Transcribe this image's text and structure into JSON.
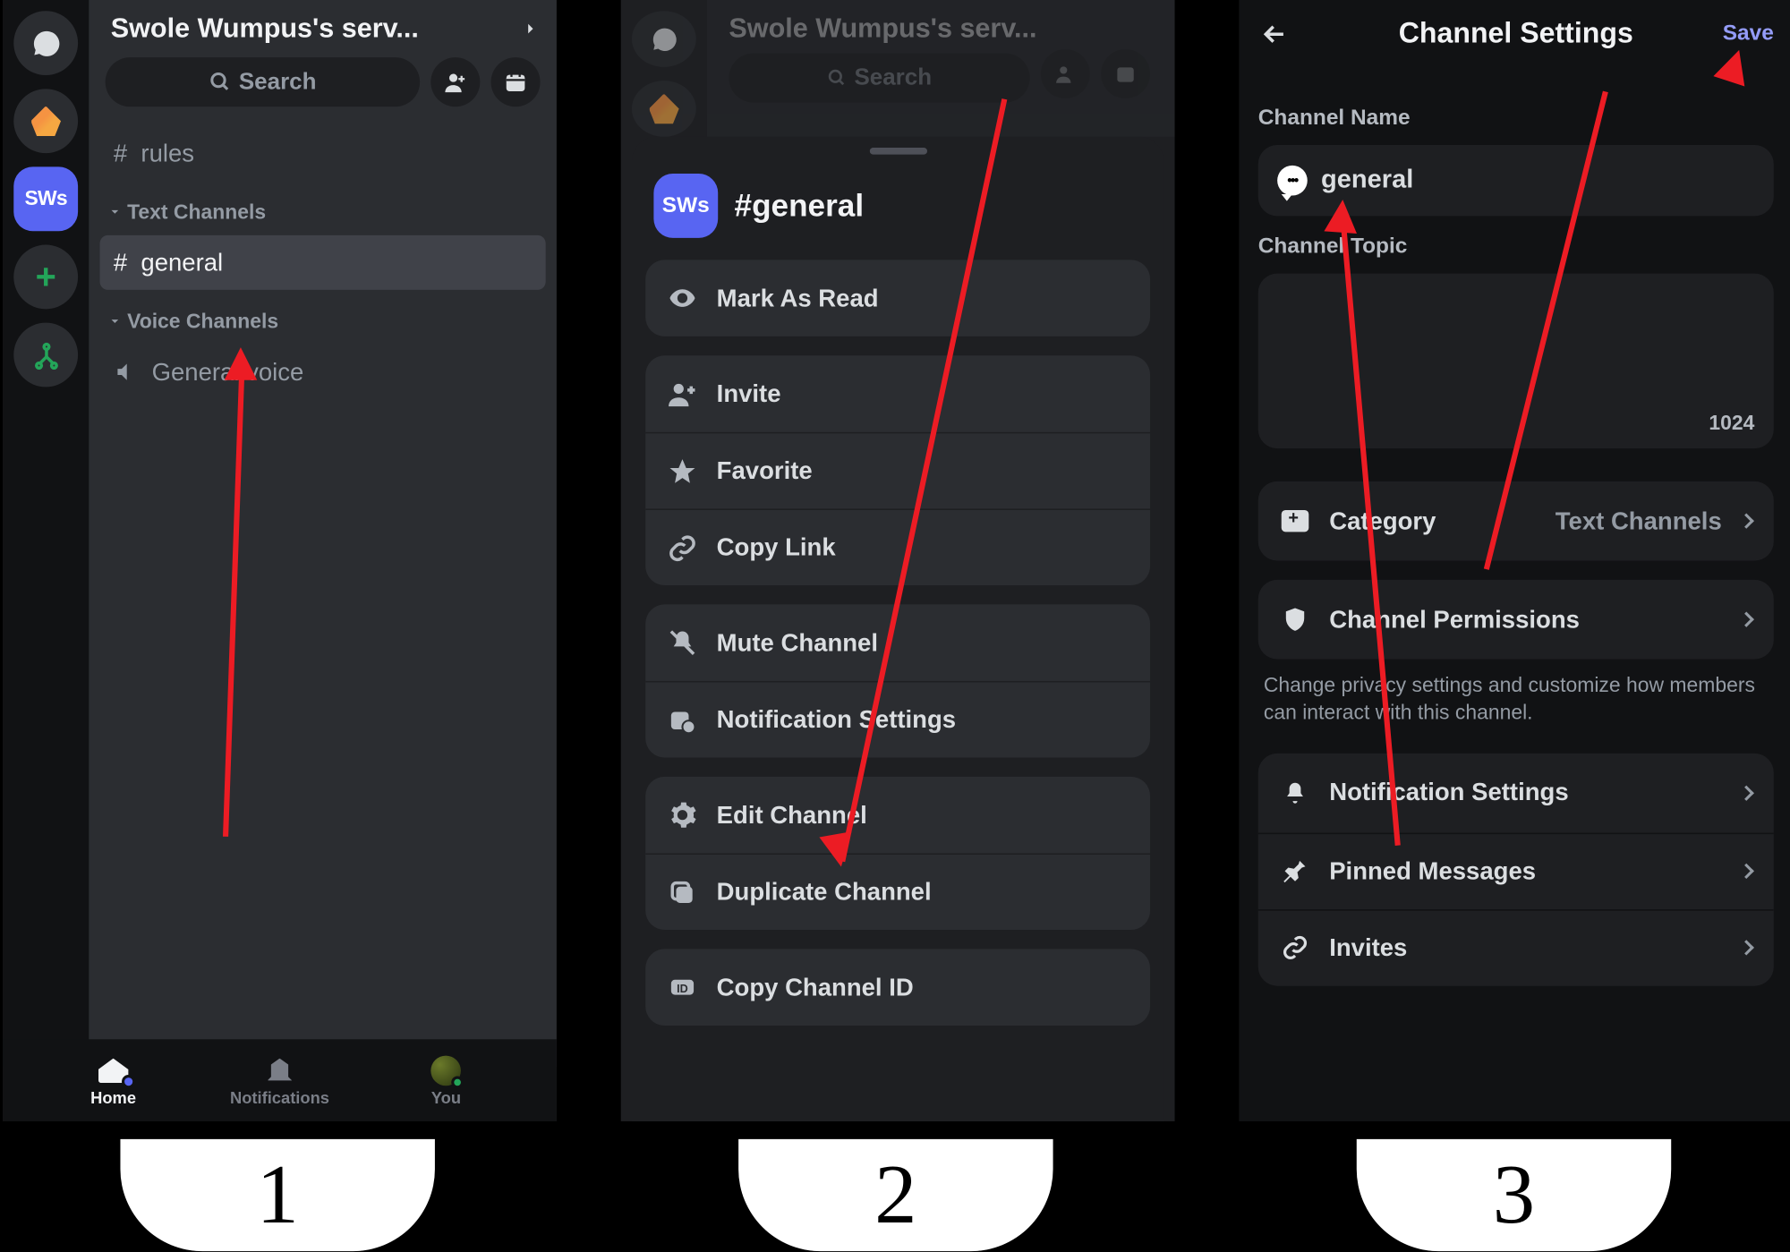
{
  "panel1": {
    "server_title": "Swole Wumpus's serv...",
    "search_label": "Search",
    "rail": {
      "sws": "SWs",
      "plus": "+"
    },
    "channels": {
      "rules": "rules",
      "text_section": "Text Channels",
      "general": "general",
      "voice_section": "Voice Channels",
      "general_voice": "General voice"
    },
    "tabs": {
      "home": "Home",
      "notifications": "Notifications",
      "you": "You"
    }
  },
  "panel2": {
    "dim_title": "Swole Wumpus's serv...",
    "dim_search": "Search",
    "sws": "SWs",
    "channel": "#general",
    "items": {
      "mark_read": "Mark As Read",
      "invite": "Invite",
      "favorite": "Favorite",
      "copy_link": "Copy Link",
      "mute": "Mute Channel",
      "notif": "Notification Settings",
      "edit": "Edit Channel",
      "duplicate": "Duplicate Channel",
      "copy_id": "Copy Channel ID"
    }
  },
  "panel3": {
    "title": "Channel Settings",
    "save": "Save",
    "name_label": "Channel Name",
    "name_value": "general",
    "topic_label": "Channel Topic",
    "char_limit": "1024",
    "category_label": "Category",
    "category_value": "Text Channels",
    "perm_label": "Channel Permissions",
    "perm_help": "Change privacy settings and customize how members can interact with this channel.",
    "notif": "Notification Settings",
    "pinned": "Pinned Messages",
    "invites": "Invites"
  },
  "steps": {
    "s1": "1",
    "s2": "2",
    "s3": "3"
  }
}
